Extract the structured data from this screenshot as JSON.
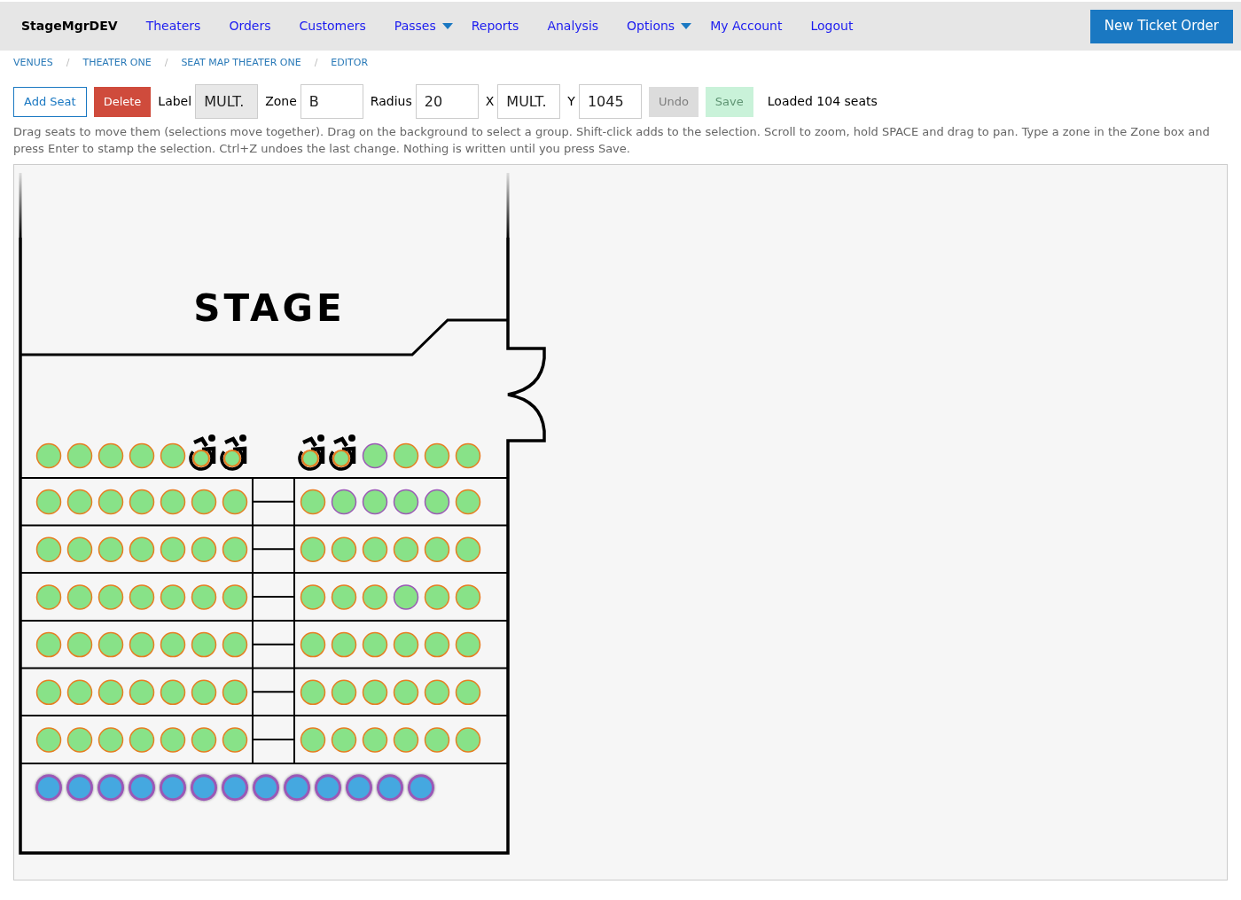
{
  "nav": {
    "brand": "StageMgrDEV",
    "links": [
      {
        "label": "Theaters",
        "kind": "link"
      },
      {
        "label": "Orders",
        "kind": "link"
      },
      {
        "label": "Customers",
        "kind": "link"
      },
      {
        "label": "Passes",
        "kind": "dropdown"
      },
      {
        "label": "Reports",
        "kind": "link"
      },
      {
        "label": "Analysis",
        "kind": "link"
      },
      {
        "label": "Options",
        "kind": "dropdown"
      },
      {
        "label": "My Account",
        "kind": "link"
      },
      {
        "label": "Logout",
        "kind": "link"
      }
    ],
    "action_button": "New Ticket Order"
  },
  "breadcrumb": [
    {
      "label": "VENUES",
      "separator": "/"
    },
    {
      "label": "THEATER ONE",
      "separator": "/"
    },
    {
      "label": "SEAT MAP THEATER ONE",
      "separator": "/"
    },
    {
      "label": "EDITOR"
    }
  ],
  "toolbar": {
    "items": [
      {
        "kind": "button",
        "label": "Add Seat",
        "disabled": false
      },
      {
        "kind": "button",
        "label": "Delete",
        "disabled": false
      },
      {
        "kind": "field",
        "label": "Label",
        "value": "MULT.",
        "disabled": true
      },
      {
        "kind": "field",
        "label": "Zone",
        "value": "B",
        "disabled": false
      },
      {
        "kind": "field",
        "label": "Radius",
        "value": "20",
        "disabled": false
      },
      {
        "kind": "field",
        "label": "X",
        "value": "MULT.",
        "disabled": false
      },
      {
        "kind": "field",
        "label": "Y",
        "value": "1045",
        "disabled": false
      },
      {
        "kind": "button",
        "label": "Undo",
        "disabled": true
      },
      {
        "kind": "button",
        "label": "Save",
        "disabled": true
      }
    ],
    "status": "Loaded 104 seats"
  },
  "instructions": "Drag seats to move them (selections move together). Drag on the background to select a group. Shift-click adds to the selection. Scroll to zoom, hold SPACE and drag to pan. Type a zone in the Zone box and press Enter to stamp the selection. Ctrl+Z undoes the last change. Nothing is written until you press Save.",
  "seat_map": {
    "stage_label": "STAGE",
    "rows": [
      {
        "sections": [
          {
            "seats": [
              {
                "kind": "seat",
                "selected": false,
                "color": "#e67e22"
              },
              {
                "kind": "seat",
                "selected": false,
                "color": "#e67e22"
              },
              {
                "kind": "seat",
                "selected": false,
                "color": "#e67e22"
              },
              {
                "kind": "seat",
                "selected": false,
                "color": "#e67e22"
              },
              {
                "kind": "seat",
                "selected": false,
                "color": "#e67e22"
              },
              {
                "kind": "wheelchair",
                "selected": false,
                "color": "#e67e22"
              },
              {
                "kind": "wheelchair",
                "selected": false,
                "color": "#e67e22"
              }
            ]
          },
          {
            "seats": [
              {
                "kind": "wheelchair",
                "selected": false,
                "color": "#e67e22"
              },
              {
                "kind": "wheelchair",
                "selected": false,
                "color": "#e67e22"
              },
              {
                "kind": "seat",
                "selected": false,
                "color": "#9b59b6"
              },
              {
                "kind": "seat",
                "selected": false,
                "color": "#e67e22"
              },
              {
                "kind": "seat",
                "selected": false,
                "color": "#e67e22"
              },
              {
                "kind": "seat",
                "selected": false,
                "color": "#e67e22"
              }
            ]
          }
        ]
      },
      {
        "sections": [
          {
            "seats": [
              {
                "kind": "seat",
                "selected": false,
                "color": "#e67e22"
              },
              {
                "kind": "seat",
                "selected": false,
                "color": "#e67e22"
              },
              {
                "kind": "seat",
                "selected": false,
                "color": "#e67e22"
              },
              {
                "kind": "seat",
                "selected": false,
                "color": "#e67e22"
              },
              {
                "kind": "seat",
                "selected": false,
                "color": "#e67e22"
              },
              {
                "kind": "seat",
                "selected": false,
                "color": "#e67e22"
              },
              {
                "kind": "seat",
                "selected": false,
                "color": "#e67e22"
              }
            ]
          },
          {
            "seats": [
              {
                "kind": "seat",
                "selected": false,
                "color": "#e67e22"
              },
              {
                "kind": "seat",
                "selected": false,
                "color": "#9b59b6"
              },
              {
                "kind": "seat",
                "selected": false,
                "color": "#9b59b6"
              },
              {
                "kind": "seat",
                "selected": false,
                "color": "#9b59b6"
              },
              {
                "kind": "seat",
                "selected": false,
                "color": "#9b59b6"
              },
              {
                "kind": "seat",
                "selected": false,
                "color": "#e67e22"
              }
            ]
          }
        ]
      },
      {
        "sections": [
          {
            "seats": [
              {
                "kind": "seat",
                "selected": false,
                "color": "#e67e22"
              },
              {
                "kind": "seat",
                "selected": false,
                "color": "#e67e22"
              },
              {
                "kind": "seat",
                "selected": false,
                "color": "#e67e22"
              },
              {
                "kind": "seat",
                "selected": false,
                "color": "#e67e22"
              },
              {
                "kind": "seat",
                "selected": false,
                "color": "#e67e22"
              },
              {
                "kind": "seat",
                "selected": false,
                "color": "#e67e22"
              },
              {
                "kind": "seat",
                "selected": false,
                "color": "#e67e22"
              }
            ]
          },
          {
            "seats": [
              {
                "kind": "seat",
                "selected": false,
                "color": "#e67e22"
              },
              {
                "kind": "seat",
                "selected": false,
                "color": "#e67e22"
              },
              {
                "kind": "seat",
                "selected": false,
                "color": "#e67e22"
              },
              {
                "kind": "seat",
                "selected": false,
                "color": "#e67e22"
              },
              {
                "kind": "seat",
                "selected": false,
                "color": "#e67e22"
              },
              {
                "kind": "seat",
                "selected": false,
                "color": "#e67e22"
              }
            ]
          }
        ]
      },
      {
        "sections": [
          {
            "seats": [
              {
                "kind": "seat",
                "selected": false,
                "color": "#e67e22"
              },
              {
                "kind": "seat",
                "selected": false,
                "color": "#e67e22"
              },
              {
                "kind": "seat",
                "selected": false,
                "color": "#e67e22"
              },
              {
                "kind": "seat",
                "selected": false,
                "color": "#e67e22"
              },
              {
                "kind": "seat",
                "selected": false,
                "color": "#e67e22"
              },
              {
                "kind": "seat",
                "selected": false,
                "color": "#e67e22"
              },
              {
                "kind": "seat",
                "selected": false,
                "color": "#e67e22"
              }
            ]
          },
          {
            "seats": [
              {
                "kind": "seat",
                "selected": false,
                "color": "#e67e22"
              },
              {
                "kind": "seat",
                "selected": false,
                "color": "#e67e22"
              },
              {
                "kind": "seat",
                "selected": false,
                "color": "#e67e22"
              },
              {
                "kind": "seat",
                "selected": false,
                "color": "#9b59b6"
              },
              {
                "kind": "seat",
                "selected": false,
                "color": "#e67e22"
              },
              {
                "kind": "seat",
                "selected": false,
                "color": "#e67e22"
              }
            ]
          }
        ]
      },
      {
        "sections": [
          {
            "seats": [
              {
                "kind": "seat",
                "selected": false,
                "color": "#e67e22"
              },
              {
                "kind": "seat",
                "selected": false,
                "color": "#e67e22"
              },
              {
                "kind": "seat",
                "selected": false,
                "color": "#e67e22"
              },
              {
                "kind": "seat",
                "selected": false,
                "color": "#e67e22"
              },
              {
                "kind": "seat",
                "selected": false,
                "color": "#e67e22"
              },
              {
                "kind": "seat",
                "selected": false,
                "color": "#e67e22"
              },
              {
                "kind": "seat",
                "selected": false,
                "color": "#e67e22"
              }
            ]
          },
          {
            "seats": [
              {
                "kind": "seat",
                "selected": false,
                "color": "#e67e22"
              },
              {
                "kind": "seat",
                "selected": false,
                "color": "#e67e22"
              },
              {
                "kind": "seat",
                "selected": false,
                "color": "#e67e22"
              },
              {
                "kind": "seat",
                "selected": false,
                "color": "#e67e22"
              },
              {
                "kind": "seat",
                "selected": false,
                "color": "#e67e22"
              },
              {
                "kind": "seat",
                "selected": false,
                "color": "#e67e22"
              }
            ]
          }
        ]
      },
      {
        "sections": [
          {
            "seats": [
              {
                "kind": "seat",
                "selected": false,
                "color": "#e67e22"
              },
              {
                "kind": "seat",
                "selected": false,
                "color": "#e67e22"
              },
              {
                "kind": "seat",
                "selected": false,
                "color": "#e67e22"
              },
              {
                "kind": "seat",
                "selected": false,
                "color": "#e67e22"
              },
              {
                "kind": "seat",
                "selected": false,
                "color": "#e67e22"
              },
              {
                "kind": "seat",
                "selected": false,
                "color": "#e67e22"
              },
              {
                "kind": "seat",
                "selected": false,
                "color": "#e67e22"
              }
            ]
          },
          {
            "seats": [
              {
                "kind": "seat",
                "selected": false,
                "color": "#e67e22"
              },
              {
                "kind": "seat",
                "selected": false,
                "color": "#e67e22"
              },
              {
                "kind": "seat",
                "selected": false,
                "color": "#e67e22"
              },
              {
                "kind": "seat",
                "selected": false,
                "color": "#e67e22"
              },
              {
                "kind": "seat",
                "selected": false,
                "color": "#e67e22"
              },
              {
                "kind": "seat",
                "selected": false,
                "color": "#e67e22"
              }
            ]
          }
        ]
      },
      {
        "sections": [
          {
            "seats": [
              {
                "kind": "seat",
                "selected": false,
                "color": "#e67e22"
              },
              {
                "kind": "seat",
                "selected": false,
                "color": "#e67e22"
              },
              {
                "kind": "seat",
                "selected": false,
                "color": "#e67e22"
              },
              {
                "kind": "seat",
                "selected": false,
                "color": "#e67e22"
              },
              {
                "kind": "seat",
                "selected": false,
                "color": "#e67e22"
              },
              {
                "kind": "seat",
                "selected": false,
                "color": "#e67e22"
              },
              {
                "kind": "seat",
                "selected": false,
                "color": "#e67e22"
              }
            ]
          },
          {
            "seats": [
              {
                "kind": "seat",
                "selected": false,
                "color": "#e67e22"
              },
              {
                "kind": "seat",
                "selected": false,
                "color": "#e67e22"
              },
              {
                "kind": "seat",
                "selected": false,
                "color": "#e67e22"
              },
              {
                "kind": "seat",
                "selected": false,
                "color": "#e67e22"
              },
              {
                "kind": "seat",
                "selected": false,
                "color": "#e67e22"
              },
              {
                "kind": "seat",
                "selected": false,
                "color": "#e67e22"
              }
            ]
          }
        ]
      },
      {
        "sections": [
          {
            "seats": [
              {
                "kind": "seat",
                "selected": true,
                "color": "#9b59b6"
              },
              {
                "kind": "seat",
                "selected": true,
                "color": "#9b59b6"
              },
              {
                "kind": "seat",
                "selected": true,
                "color": "#9b59b6"
              },
              {
                "kind": "seat",
                "selected": true,
                "color": "#9b59b6"
              },
              {
                "kind": "seat",
                "selected": true,
                "color": "#9b59b6"
              },
              {
                "kind": "seat",
                "selected": true,
                "color": "#9b59b6"
              },
              {
                "kind": "seat",
                "selected": true,
                "color": "#9b59b6"
              },
              {
                "kind": "seat",
                "selected": true,
                "color": "#9b59b6"
              },
              {
                "kind": "seat",
                "selected": true,
                "color": "#9b59b6"
              },
              {
                "kind": "seat",
                "selected": true,
                "color": "#9b59b6"
              },
              {
                "kind": "seat",
                "selected": true,
                "color": "#9b59b6"
              },
              {
                "kind": "seat",
                "selected": true,
                "color": "#9b59b6"
              },
              {
                "kind": "seat",
                "selected": true,
                "color": "#9b59b6"
              }
            ]
          }
        ]
      }
    ]
  }
}
